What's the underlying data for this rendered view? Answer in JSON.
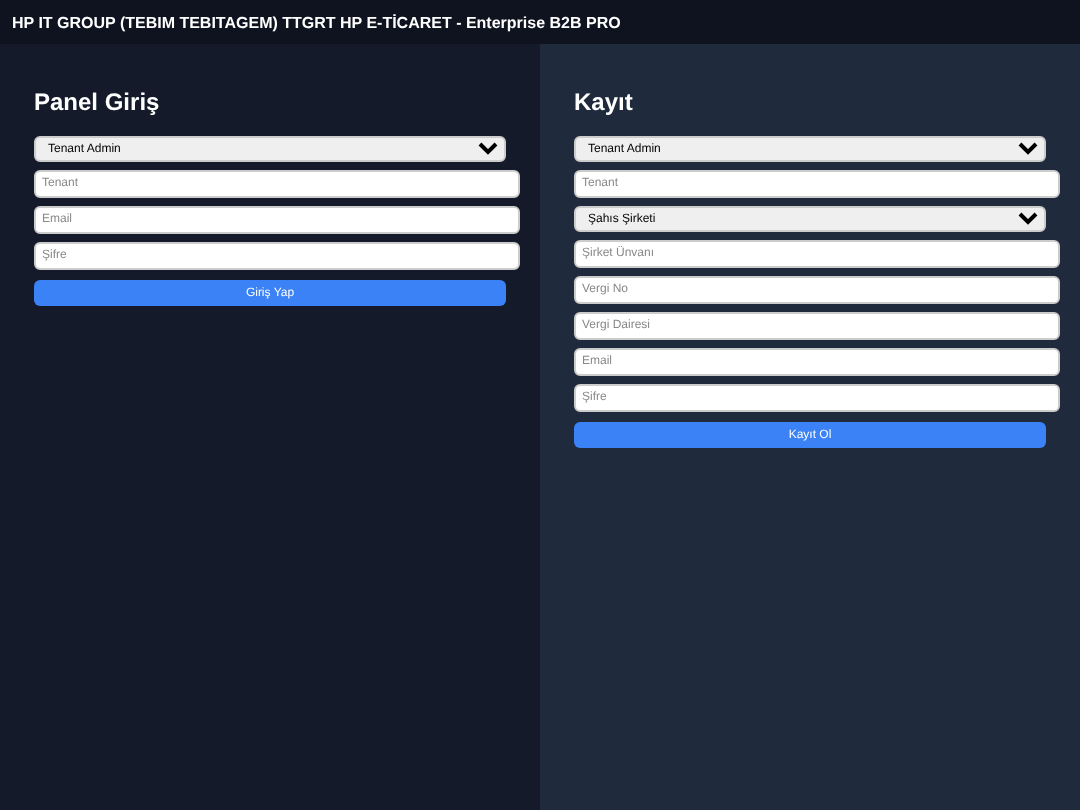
{
  "header": {
    "title": "HP IT GROUP (TEBIM TEBITAGEM) TTGRT HP E-TİCARET - Enterprise B2B PRO"
  },
  "panels": [
    {
      "title": "Panel Giriş",
      "fields": [
        {
          "kind": "select",
          "value": "Tenant Admin"
        },
        {
          "kind": "input",
          "placeholder": "Tenant"
        },
        {
          "kind": "input",
          "placeholder": "Email"
        },
        {
          "kind": "input",
          "placeholder": "Şifre"
        }
      ],
      "button": "Giriş Yap"
    },
    {
      "title": "Kayıt",
      "fields": [
        {
          "kind": "select",
          "value": "Tenant Admin"
        },
        {
          "kind": "input",
          "placeholder": "Tenant"
        },
        {
          "kind": "select",
          "value": "Şahıs Şirketi"
        },
        {
          "kind": "input",
          "placeholder": "Şirket Ünvanı"
        },
        {
          "kind": "input",
          "placeholder": "Vergi No"
        },
        {
          "kind": "input",
          "placeholder": "Vergi Dairesi"
        },
        {
          "kind": "input",
          "placeholder": "Email"
        },
        {
          "kind": "input",
          "placeholder": "Şifre"
        }
      ],
      "button": "Kayıt Ol"
    }
  ]
}
